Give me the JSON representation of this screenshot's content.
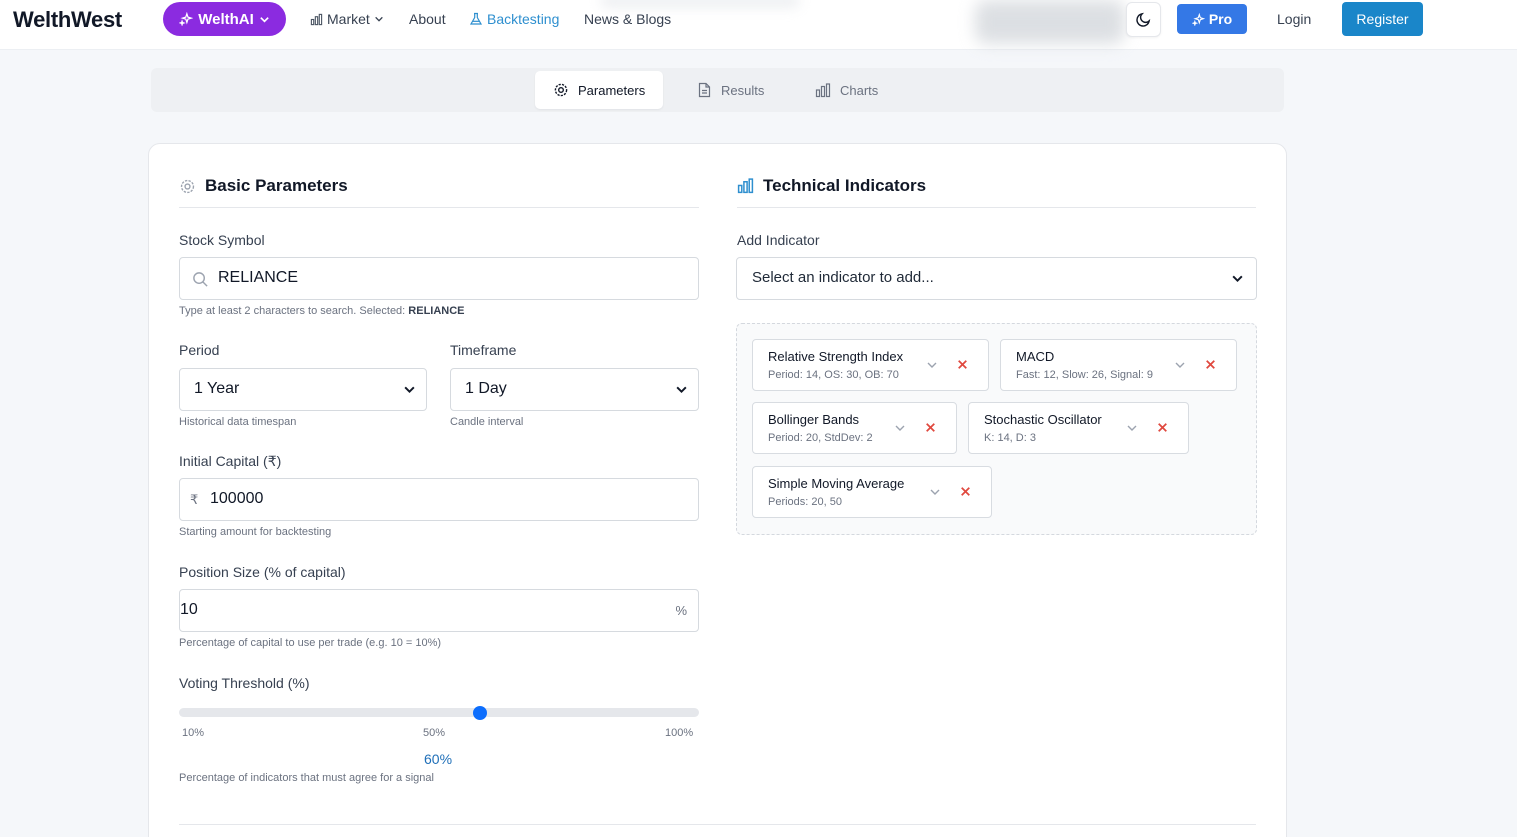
{
  "nav": {
    "logo": "WelthWest",
    "ai_button": "WelthAI",
    "links": {
      "market": "Market",
      "about": "About",
      "backtesting": "Backtesting",
      "news": "News & Blogs"
    },
    "pro_button": "Pro",
    "login": "Login",
    "register": "Register"
  },
  "tabs": {
    "parameters": "Parameters",
    "results": "Results",
    "charts": "Charts"
  },
  "basic": {
    "title": "Basic Parameters",
    "stock_symbol": {
      "label": "Stock Symbol",
      "value": "RELIANCE",
      "hint_prefix": "Type at least 2 characters to search. Selected:",
      "hint_selected": "RELIANCE"
    },
    "period": {
      "label": "Period",
      "value": "1 Year",
      "hint": "Historical data timespan"
    },
    "timeframe": {
      "label": "Timeframe",
      "value": "1 Day",
      "hint": "Candle interval"
    },
    "initial_capital": {
      "label": "Initial Capital (₹)",
      "prefix": "₹",
      "value": "100000",
      "hint": "Starting amount for backtesting"
    },
    "position_size": {
      "label": "Position Size (% of capital)",
      "value": "10",
      "suffix": "%",
      "hint": "Percentage of capital to use per trade (e.g. 10 = 10%)"
    },
    "voting": {
      "label": "Voting Threshold (%)",
      "min_label": "10%",
      "mid_label": "50%",
      "max_label": "100%",
      "value_label": "60%",
      "value": 60,
      "min": 10,
      "max": 100,
      "hint": "Percentage of indicators that must agree for a signal"
    }
  },
  "technical": {
    "title": "Technical Indicators",
    "add_label": "Add Indicator",
    "add_placeholder": "Select an indicator to add...",
    "indicators": [
      {
        "name": "Relative Strength Index",
        "params": "Period: 14, OS: 30, OB: 70"
      },
      {
        "name": "MACD",
        "params": "Fast: 12, Slow: 26, Signal: 9"
      },
      {
        "name": "Bollinger Bands",
        "params": "Period: 20, StdDev: 2"
      },
      {
        "name": "Stochastic Oscillator",
        "params": "K: 14, D: 3"
      },
      {
        "name": "Simple Moving Average",
        "params": "Periods: 20, 50"
      }
    ]
  },
  "colors": {
    "accent": "#2e8fcf",
    "ai_purple": "#8b2be0",
    "pro_blue": "#3478e6",
    "register_blue": "#1a86c9",
    "remove_red": "#e0483e",
    "slider_blue": "#0d6efd"
  }
}
